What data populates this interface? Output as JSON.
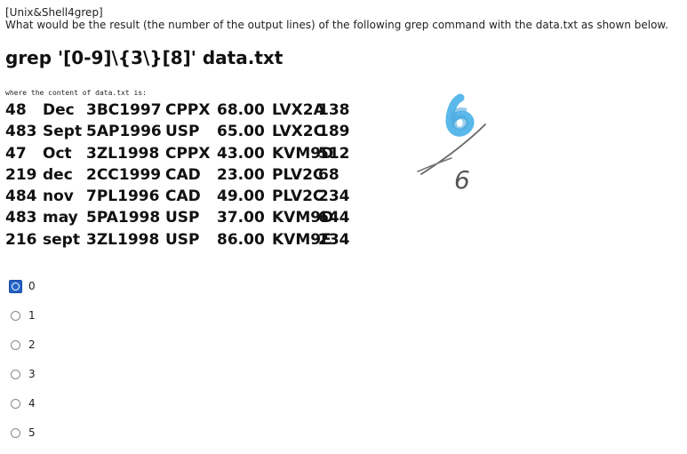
{
  "question": {
    "tag": "[Unix&Shell4grep]",
    "text": "What would be the result (the number of the output lines) of the following grep command with the data.txt as shown below.",
    "command": "grep '[0-9]\\{3\\}[8]' data.txt",
    "where_label": "where the content of data.txt is:"
  },
  "data_rows": [
    [
      "48",
      "Dec",
      "3BC1997",
      "CPPX",
      "68.00",
      "LVX2A",
      "138"
    ],
    [
      "483",
      "Sept",
      "5AP1996",
      "USP",
      "65.00",
      "LVX2C",
      "189"
    ],
    [
      "47",
      "Oct",
      "3ZL1998",
      "CPPX",
      "43.00",
      "KVM9D",
      "512"
    ],
    [
      "219",
      "dec",
      "2CC1999",
      "CAD",
      "23.00",
      "PLV2C",
      "68"
    ],
    [
      "484",
      "nov",
      "7PL1996",
      "CAD",
      "49.00",
      "PLV2C",
      "234"
    ],
    [
      "483",
      "may",
      "5PA1998",
      "USP",
      "37.00",
      "KVM9D",
      "644"
    ],
    [
      "216",
      "sept",
      "3ZL1998",
      "USP",
      "86.00",
      "KVM9E",
      "234"
    ]
  ],
  "annotation": {
    "highlight_text": "6",
    "handwritten_text": "6",
    "highlight_color": "#5ab8ea",
    "ink_color": "#555555"
  },
  "options": [
    {
      "label": "0",
      "selected": true
    },
    {
      "label": "1",
      "selected": false
    },
    {
      "label": "2",
      "selected": false
    },
    {
      "label": "3",
      "selected": false
    },
    {
      "label": "4",
      "selected": false
    },
    {
      "label": "5",
      "selected": false
    }
  ],
  "colors": {
    "selected_radio": "#2463c7",
    "text": "#111111"
  }
}
